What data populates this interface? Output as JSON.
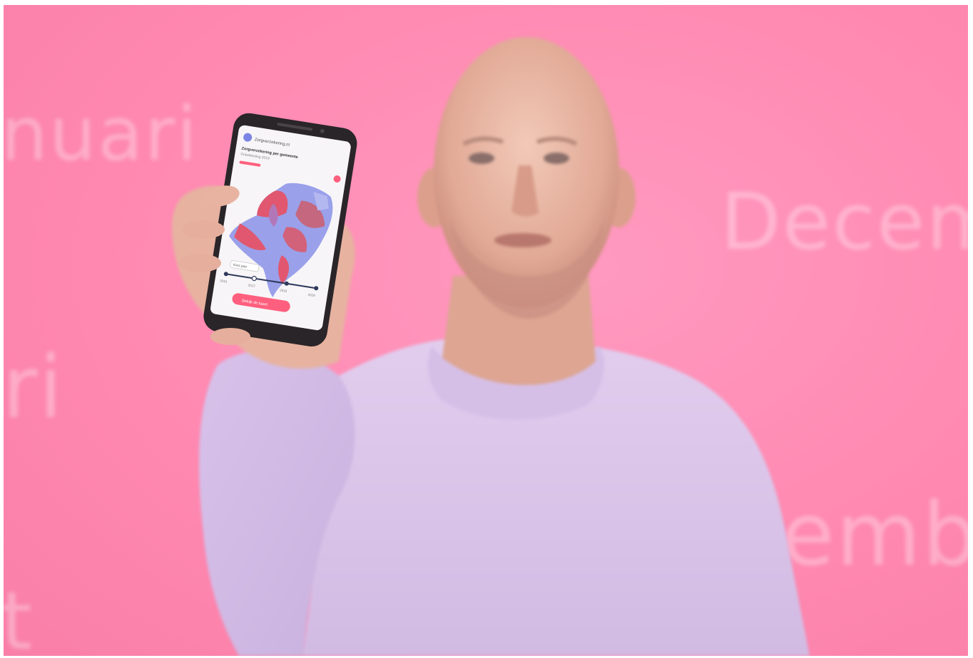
{
  "background": {
    "color": "#ff89b1",
    "words": [
      "nuari",
      "Decem",
      "ri",
      "emb",
      "t"
    ]
  },
  "phone": {
    "app_name": "Zorgverzekering.nl",
    "heading": "Zorgverzekering per gemeente",
    "subheading": "Ontwikkeling 2019",
    "button_label": "Bekijk de kaart",
    "dropdown_value": "Kies jaar",
    "timeline_labels": [
      "2016",
      "2017",
      "2018",
      "2019"
    ],
    "accent_color": "#ff5f7e",
    "map_colors": [
      "#e0576f",
      "#8f96e6",
      "#c07bb4"
    ]
  },
  "person": {
    "sweater_color": "#dcc4ea",
    "skin_color": "#e8b8a6"
  }
}
